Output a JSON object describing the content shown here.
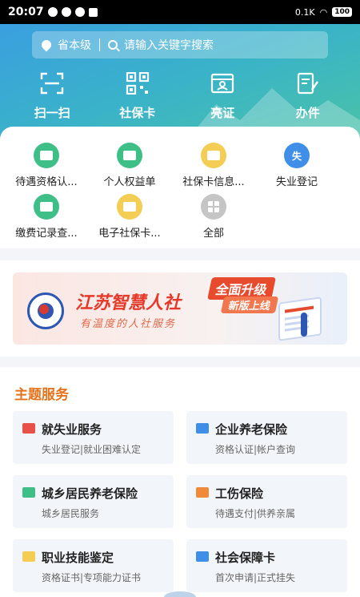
{
  "status_bar": {
    "time": "20:07",
    "network": "0.1K",
    "battery": "100"
  },
  "search": {
    "location": "省本级",
    "placeholder": "请输入关键字搜索"
  },
  "quick_actions": [
    {
      "label": "扫一扫",
      "icon": "scan-icon"
    },
    {
      "label": "社保卡",
      "icon": "qrcode-icon"
    },
    {
      "label": "亮证",
      "icon": "id-card-icon"
    },
    {
      "label": "办件",
      "icon": "document-edit-icon"
    }
  ],
  "services_grid": [
    {
      "label": "待遇资格认...",
      "icon": "envelope-icon",
      "color": "green"
    },
    {
      "label": "个人权益单",
      "icon": "envelope-icon",
      "color": "green"
    },
    {
      "label": "社保卡信息...",
      "icon": "envelope-icon",
      "color": "yellow"
    },
    {
      "label": "失业登记",
      "icon": "unemployment-icon",
      "color": "blue",
      "glyph": "失"
    },
    {
      "label": "缴费记录查...",
      "icon": "envelope-icon",
      "color": "green"
    },
    {
      "label": "电子社保卡...",
      "icon": "envelope-icon",
      "color": "yellow"
    },
    {
      "label": "全部",
      "icon": "grid-icon",
      "color": "gray"
    }
  ],
  "banner": {
    "title": "江苏智慧人社",
    "subtitle": "有温度的人社服务",
    "badge_top": "全面升级",
    "badge_bottom": "新版上线"
  },
  "themes": {
    "heading": "主题服务",
    "items": [
      {
        "title": "就失业服务",
        "desc": "失业登记|就业困难认定",
        "icon": "briefcase-icon",
        "color": "#e8504a"
      },
      {
        "title": "企业养老保险",
        "desc": "资格认证|帐户查询",
        "icon": "person-icon",
        "color": "#3f8ee8"
      },
      {
        "title": "城乡居民养老保险",
        "desc": "城乡居民服务",
        "icon": "person-icon",
        "color": "#3fbf88"
      },
      {
        "title": "工伤保险",
        "desc": "待遇支付|供养亲属",
        "icon": "person-icon",
        "color": "#f08a3a"
      },
      {
        "title": "职业技能鉴定",
        "desc": "资格证书|专项能力证书",
        "icon": "certificate-icon",
        "color": "#f4cd55"
      },
      {
        "title": "社会保障卡",
        "desc": "首次申请|正式挂失",
        "icon": "card-icon",
        "color": "#3f8ee8"
      }
    ]
  }
}
